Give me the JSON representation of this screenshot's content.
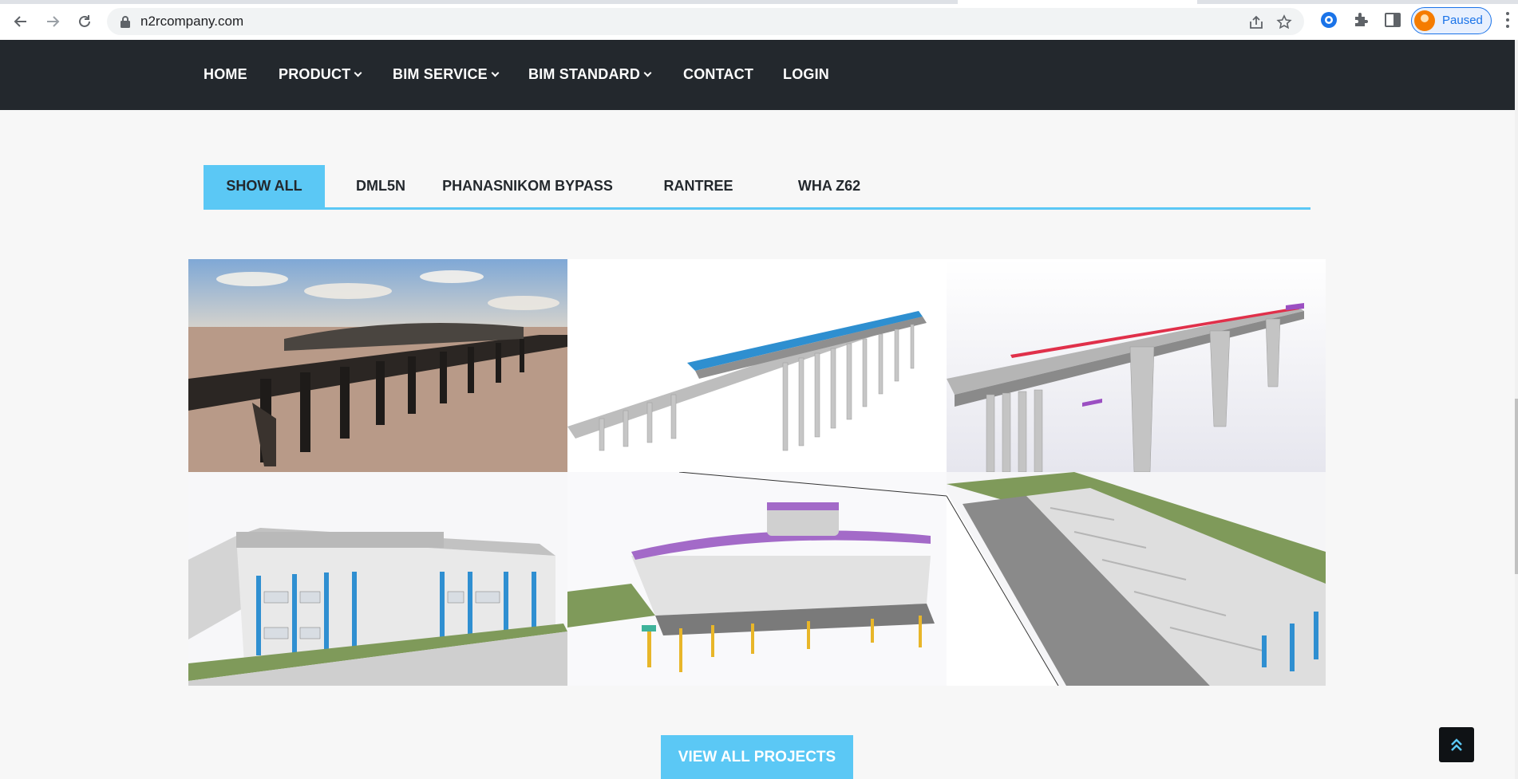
{
  "browser": {
    "url": "n2rcompany.com",
    "profile_status": "Paused",
    "icons": [
      "back-icon",
      "forward-icon",
      "reload-icon",
      "lock-icon",
      "share-icon",
      "star-icon",
      "extension-icon",
      "puzzle-icon",
      "sidepanel-icon",
      "menu-icon"
    ]
  },
  "nav": {
    "items": [
      {
        "label": "HOME",
        "dropdown": false
      },
      {
        "label": "PRODUCT",
        "dropdown": true
      },
      {
        "label": "BIM SERVICE",
        "dropdown": true
      },
      {
        "label": "BIM STANDARD",
        "dropdown": true
      },
      {
        "label": "CONTACT",
        "dropdown": false
      },
      {
        "label": "LOGIN",
        "dropdown": false
      }
    ]
  },
  "filters": {
    "tabs": [
      "SHOW ALL",
      "DML5N",
      "PHANASNIKOM BYPASS",
      "RANTREE",
      "WHA Z62"
    ],
    "active": "SHOW ALL"
  },
  "gallery": {
    "tiles": [
      "railway-station-render",
      "bridge-deck-model",
      "highway-viaduct-model",
      "office-building-model",
      "factory-section-model",
      "building-cutaway-model"
    ]
  },
  "cta": {
    "label": "VIEW ALL PROJECTS"
  },
  "colors": {
    "nav_bg": "#23282d",
    "accent": "#5bc8f5",
    "page_bg": "#f7f7f7"
  }
}
